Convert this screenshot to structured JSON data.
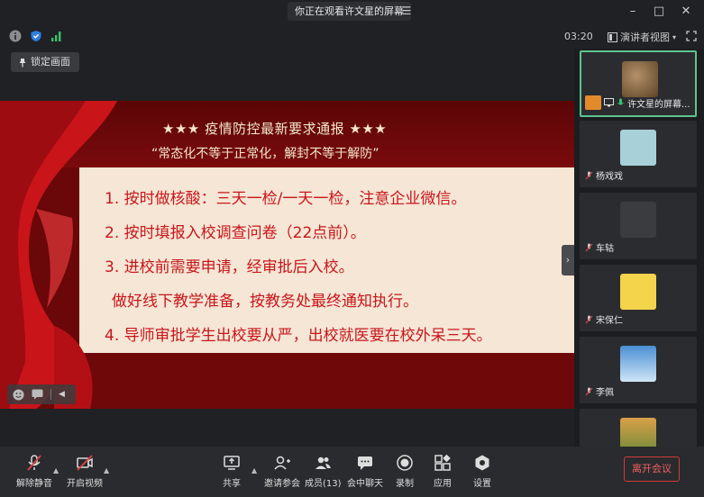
{
  "window": {
    "title": "你正在观看许文星的屏幕",
    "menu_glyph": "☰"
  },
  "status": {
    "time": "03:20",
    "view_label": "演讲者视图"
  },
  "lock": {
    "label": "锁定画面"
  },
  "slide": {
    "title": "★★★ 疫情防控最新要求通报 ★★★",
    "subtitle": "“常态化不等于正常化，解封不等于解防”",
    "lines": [
      "1. 按时做核酸：三天一检/一天一检，注意企业微信。",
      "2. 按时填报入校调查问卷（22点前）。",
      "3. 进校前需要申请，经审批后入校。",
      "做好线下教学准备，按教务处最终通知执行。",
      "4. 导师审批学生出校要从严，出校就医要在校外呆三天。"
    ]
  },
  "participants": [
    {
      "name": "许文星的屏幕...",
      "avatar_color": "#8a6b45"
    },
    {
      "name": "杨戏戏",
      "avatar_color": "#a8d0d8"
    },
    {
      "name": "车轱",
      "avatar_color": "#3a3c40"
    },
    {
      "name": "宋保仁",
      "avatar_color": "#f3d44a"
    },
    {
      "name": "李佩",
      "avatar_color": "#5b9ed6"
    },
    {
      "name": "",
      "avatar_color": "#c98a2e"
    }
  ],
  "toolbar": {
    "unmute": "解除静音",
    "start_video": "开启视频",
    "share": "共享",
    "invite": "邀请参会",
    "members": "成员(13)",
    "chat": "会中聊天",
    "record": "录制",
    "apps": "应用",
    "settings": "设置",
    "leave": "离开会议"
  },
  "colors": {
    "accent_green": "#5cc48f",
    "leave_red": "#f06060",
    "slide_red": "#c8161a"
  }
}
